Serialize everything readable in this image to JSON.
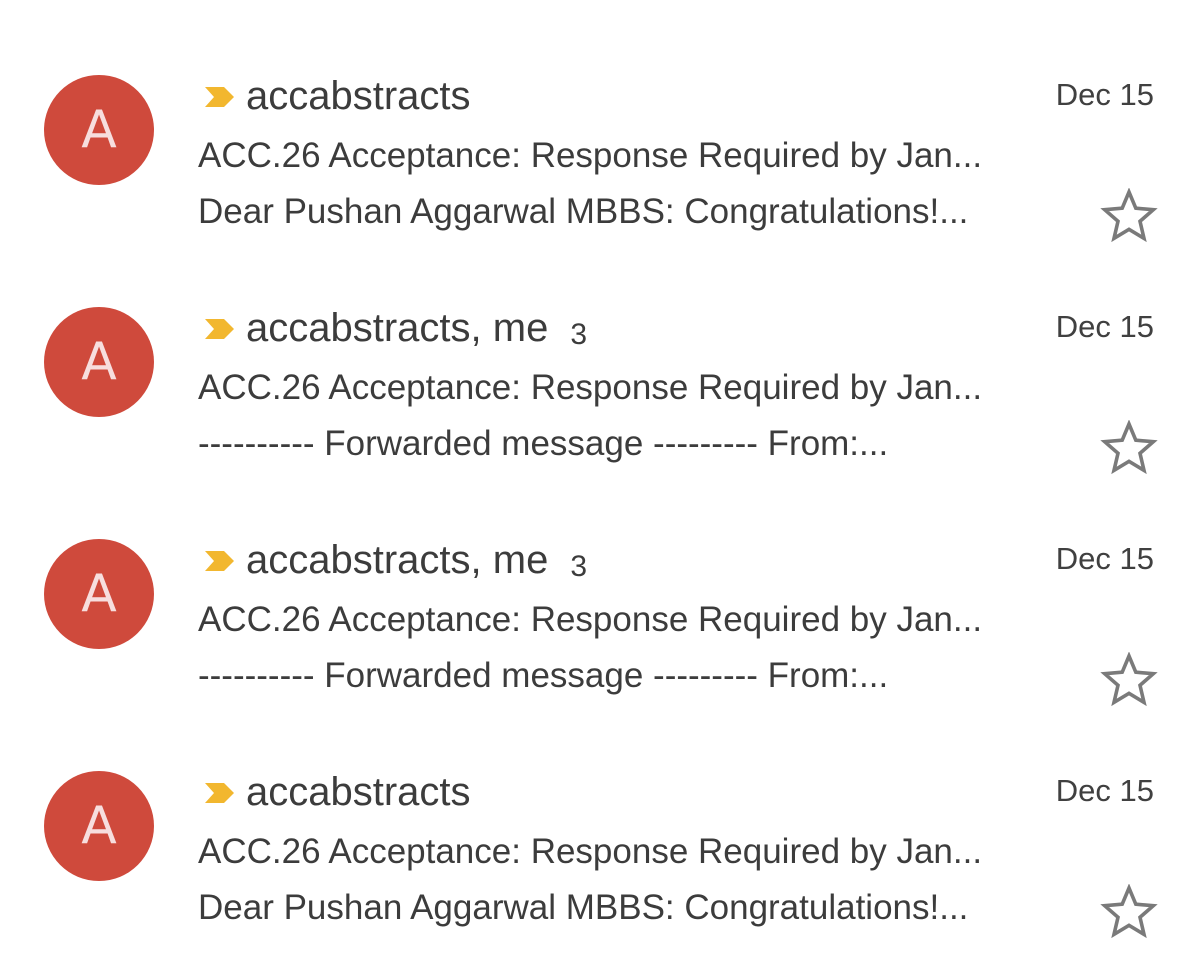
{
  "colors": {
    "avatar": "#cf4a3c",
    "importance": "#f2b72f",
    "text": "#3c3c3c",
    "star_outline": "#7a7a7a"
  },
  "emails": [
    {
      "avatar_letter": "A",
      "importance_icon": "importance-marker-icon",
      "sender": "accabstracts",
      "thread_count": "",
      "date": "Dec 15",
      "subject": "ACC.26 Acceptance: Response Required by Jan...",
      "snippet": "Dear Pushan Aggarwal MBBS: Congratulations!...",
      "starred": false
    },
    {
      "avatar_letter": "A",
      "importance_icon": "importance-marker-icon",
      "sender": "accabstracts, me",
      "thread_count": "3",
      "date": "Dec 15",
      "subject": "ACC.26 Acceptance: Response Required by Jan...",
      "snippet": "---------- Forwarded message --------- From:...",
      "starred": false
    },
    {
      "avatar_letter": "A",
      "importance_icon": "importance-marker-icon",
      "sender": "accabstracts, me",
      "thread_count": "3",
      "date": "Dec 15",
      "subject": "ACC.26 Acceptance: Response Required by Jan...",
      "snippet": "---------- Forwarded message --------- From:...",
      "starred": false
    },
    {
      "avatar_letter": "A",
      "importance_icon": "importance-marker-icon",
      "sender": "accabstracts",
      "thread_count": "",
      "date": "Dec 15",
      "subject": "ACC.26 Acceptance: Response Required by Jan...",
      "snippet": "Dear Pushan Aggarwal MBBS: Congratulations!...",
      "starred": false
    }
  ]
}
